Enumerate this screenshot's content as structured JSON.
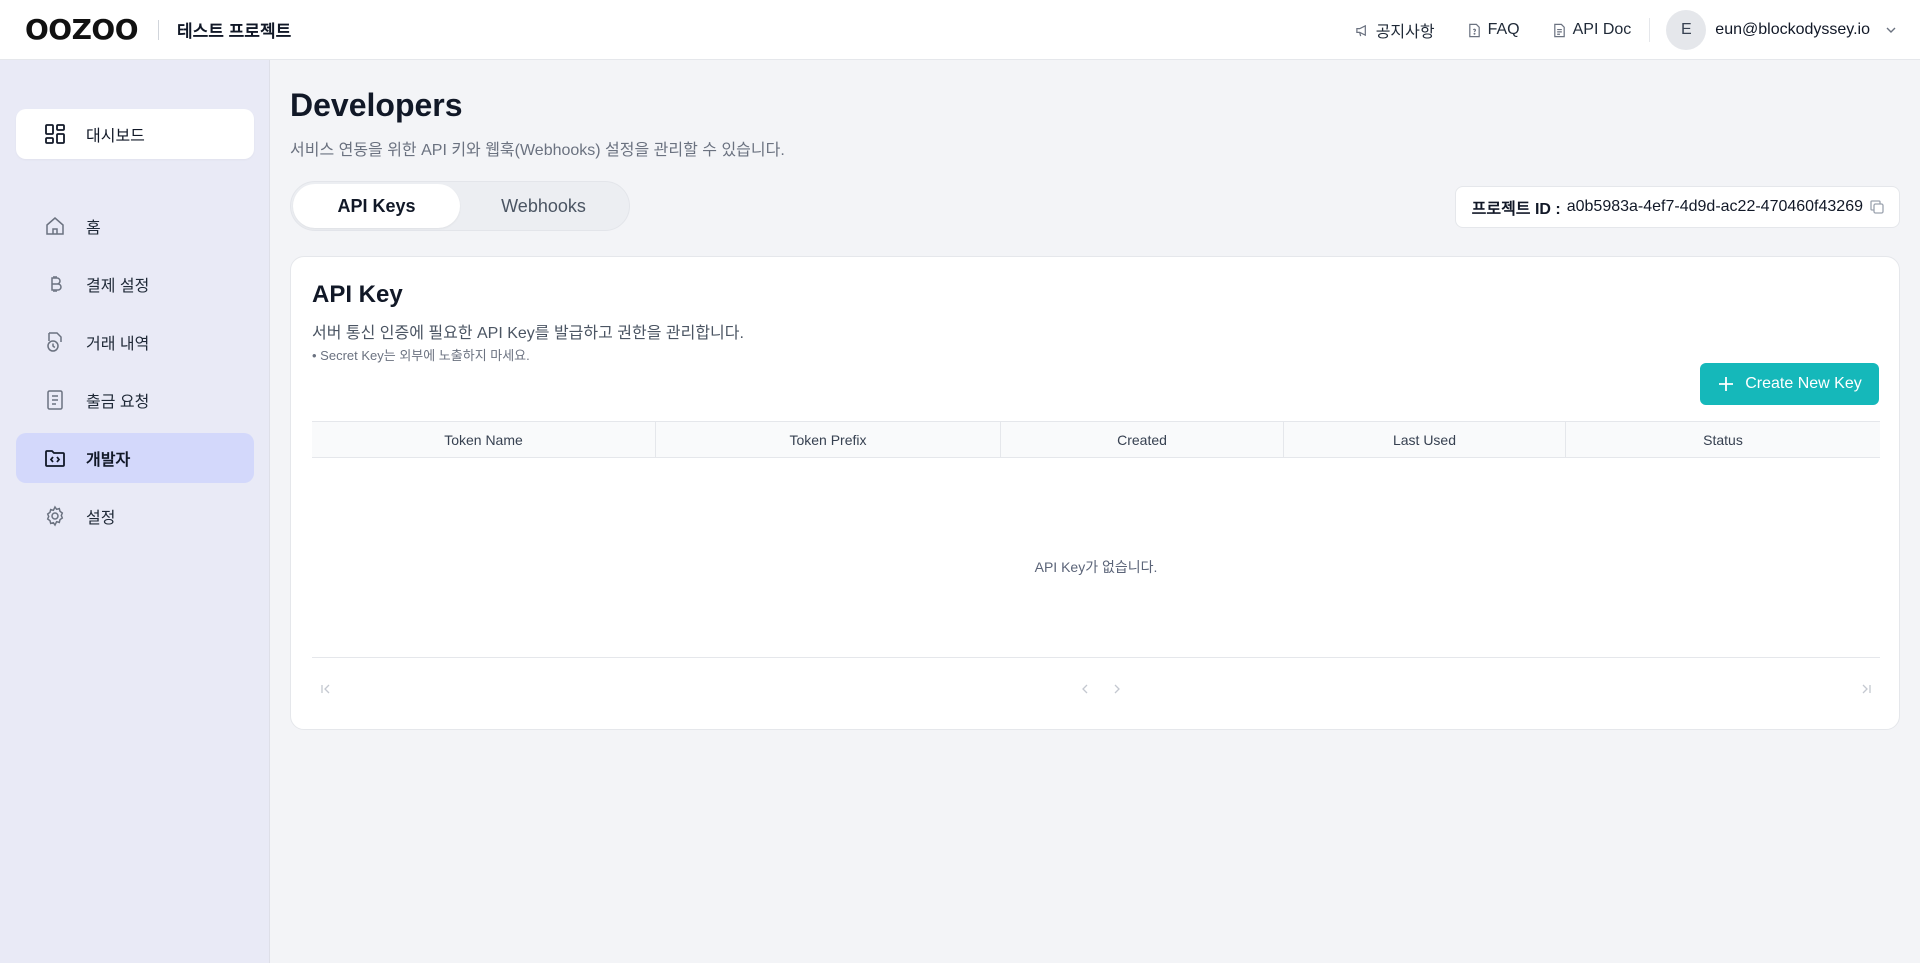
{
  "header": {
    "logo": "OOZOO",
    "project_name": "테스트 프로젝트",
    "links": {
      "notice": "공지사항",
      "faq": "FAQ",
      "api_doc": "API Doc"
    },
    "user": {
      "avatar_initial": "E",
      "email": "eun@blockodyssey.io"
    }
  },
  "sidebar": {
    "dashboard": "대시보드",
    "items": [
      {
        "label": "홈",
        "icon": "home-icon"
      },
      {
        "label": "결제 설정",
        "icon": "bitcoin-icon"
      },
      {
        "label": "거래 내역",
        "icon": "transaction-history-icon"
      },
      {
        "label": "출금 요청",
        "icon": "document-list-icon"
      },
      {
        "label": "개발자",
        "icon": "code-folder-icon",
        "active": true
      },
      {
        "label": "설정",
        "icon": "gear-icon"
      }
    ]
  },
  "page": {
    "title": "Developers",
    "description": "서비스 연동을 위한 API 키와 웹훅(Webhooks) 설정을 관리할 수 있습니다.",
    "tabs": [
      {
        "label": "API Keys",
        "active": true
      },
      {
        "label": "Webhooks",
        "active": false
      }
    ],
    "project_id_label": "프로젝트 ID :",
    "project_id": "a0b5983a-4ef7-4d9d-ac22-470460f43269"
  },
  "api_key_card": {
    "title": "API Key",
    "description": "서버 통신 인증에 필요한 API Key를 발급하고 권한을 관리합니다.",
    "note": "• Secret Key는 외부에 노출하지 마세요.",
    "create_button": "Create New Key",
    "columns": [
      "Token Name",
      "Token Prefix",
      "Created",
      "Last Used",
      "Status"
    ],
    "empty_message": "API Key가 없습니다."
  },
  "colors": {
    "accent": "#15b8ba",
    "sidebar_bg": "#e9eaf6",
    "sidebar_active": "#d3d8fb"
  }
}
